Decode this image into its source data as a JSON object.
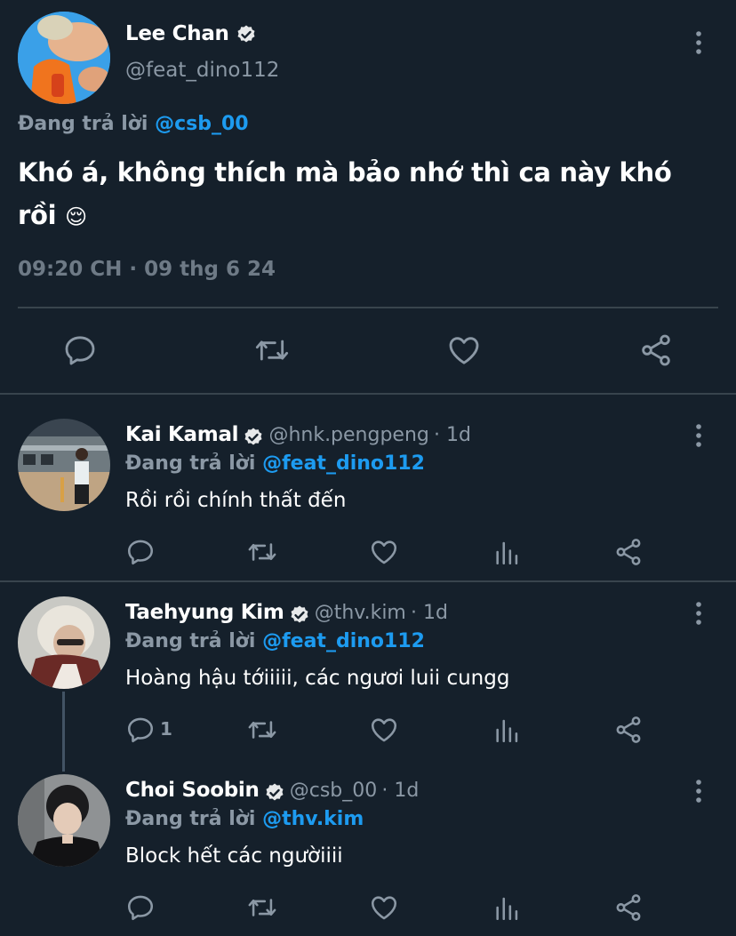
{
  "main_tweet": {
    "display_name": "Lee Chan",
    "handle": "@feat_dino112",
    "replying_prefix": "Đang trả lời",
    "replying_to": "@csb_00",
    "text_line1": "Khó á, không thích mà bảo nhớ thì ca này khó",
    "text_line2": "rồi",
    "emoji": "😌",
    "timestamp": "09:20 CH · 09 thg 6 24"
  },
  "replies": [
    {
      "display_name": "Kai Kamal",
      "handle": "@hnk.pengpeng",
      "time": "· 1d",
      "replying_prefix": "Đang trả lời",
      "replying_to": "@feat_dino112",
      "text": "Rồi rồi chính thất đến",
      "reply_count": ""
    },
    {
      "display_name": "Taehyung Kim",
      "handle": "@thv.kim",
      "time": "· 1d",
      "replying_prefix": "Đang trả lời",
      "replying_to": "@feat_dino112",
      "text": "Hoàng hậu tớiiiii, các ngươi luii cungg",
      "reply_count": "1"
    },
    {
      "display_name": "Choi Soobin",
      "handle": "@csb_00",
      "time": "· 1d",
      "replying_prefix": "Đang trả lời",
      "replying_to": "@thv.kim",
      "text": "Block hết các ngườiiii",
      "reply_count": ""
    }
  ],
  "icons": {
    "reply": "reply-icon",
    "retweet": "retweet-icon",
    "like": "heart-icon",
    "analytics": "analytics-icon",
    "share": "share-icon",
    "more": "more-icon",
    "verified": "verified-badge-icon"
  },
  "colors": {
    "background": "#15202b",
    "accent": "#1d9bf0",
    "secondary_text": "#8b98a5",
    "divider": "#38444d"
  }
}
